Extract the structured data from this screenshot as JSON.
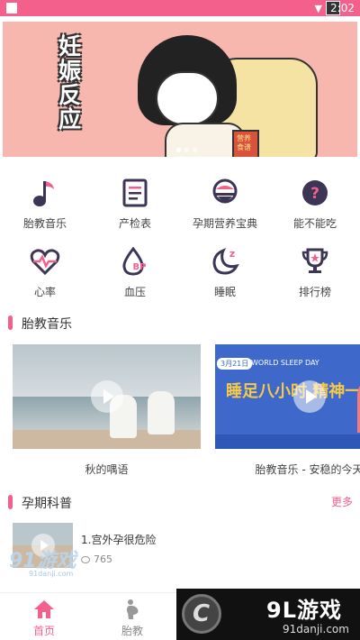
{
  "status_bar": {
    "time": "2:02"
  },
  "banner": {
    "title": "妊娠反应",
    "book_text": "营养食谱"
  },
  "quick_grid": [
    {
      "label": "胎教音乐",
      "icon": "music-note-icon"
    },
    {
      "label": "产检表",
      "icon": "document-icon"
    },
    {
      "label": "孕期营养宝典",
      "icon": "rice-bowl-icon"
    },
    {
      "label": "能不能吃",
      "icon": "question-icon"
    },
    {
      "label": "心率",
      "icon": "heartbeat-icon"
    },
    {
      "label": "血压",
      "icon": "blood-pressure-icon"
    },
    {
      "label": "睡眠",
      "icon": "moon-sleep-icon"
    },
    {
      "label": "排行榜",
      "icon": "trophy-icon"
    }
  ],
  "music_section": {
    "title": "胎教音乐",
    "cards": [
      {
        "caption": "秋的喁语"
      },
      {
        "caption": "胎教音乐 - 安稳的今天",
        "date": "3月21日",
        "tag": "WORLD SLEEP DAY",
        "headline": "睡足八小时 精神一整天"
      }
    ]
  },
  "science_section": {
    "title": "孕期科普",
    "more": "更多",
    "articles": [
      {
        "title": "1.宫外孕很危险",
        "views": "765"
      }
    ]
  },
  "tabs": [
    {
      "label": "首页",
      "icon": "home-icon",
      "active": true
    },
    {
      "label": "胎教",
      "icon": "pregnancy-icon",
      "active": false
    }
  ],
  "watermark": {
    "brand": "9L游戏",
    "url": "91danji.com",
    "url_small": "91danji.com"
  },
  "colors": {
    "accent": "#f4608c",
    "icon": "#3c3556",
    "icon_accent": "#f4608c"
  }
}
